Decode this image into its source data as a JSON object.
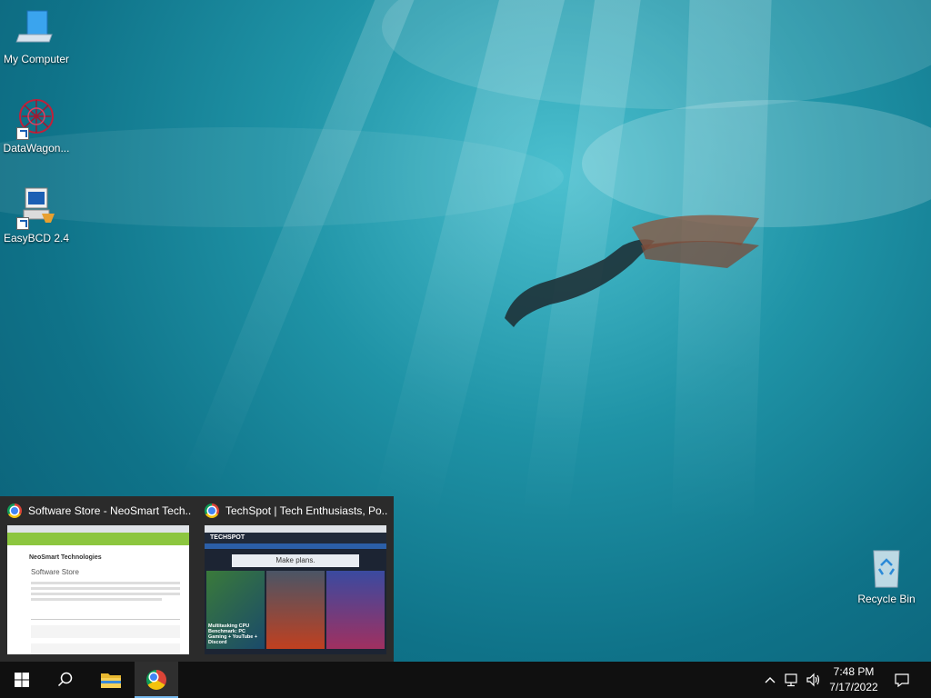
{
  "desktop": {
    "icons": [
      {
        "label": "My Computer",
        "icon": "computer-icon"
      },
      {
        "label": "DataWagon...",
        "icon": "datawagon-icon"
      },
      {
        "label": "EasyBCD 2.4",
        "icon": "easybcd-icon"
      },
      {
        "label": "Recycle Bin",
        "icon": "recycle-bin-icon"
      }
    ]
  },
  "thumbnails": [
    {
      "title": "Software Store - NeoSmart Tech...",
      "icon": "chrome-icon",
      "preview_heading": "NeoSmart Technologies",
      "preview_section": "Software Store"
    },
    {
      "title": "TechSpot | Tech Enthusiasts, Po...",
      "icon": "chrome-icon",
      "preview_heading": "TECHSPOT",
      "preview_banner": "Make plans.",
      "preview_caption": "Multitasking CPU Benchmark: PC Gaming + YouTube + Discord"
    }
  ],
  "taskbar": {
    "start": "windows-start-icon",
    "search": "search-icon",
    "pinned": [
      "file-explorer-icon",
      "chrome-icon"
    ],
    "tray": {
      "chevron": "show-hidden-icons",
      "network": "network-icon",
      "volume": "volume-icon"
    },
    "clock": {
      "time": "7:48 PM",
      "date": "7/17/2022"
    },
    "notifications": "action-center-icon"
  },
  "colors": {
    "taskbar": "#101010",
    "panel": "#2b2b2b",
    "accent": "#76b9ed"
  }
}
